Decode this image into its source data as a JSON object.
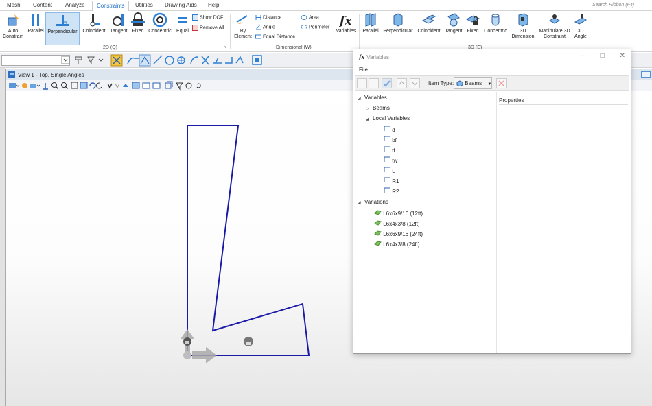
{
  "menu": {
    "tabs": [
      "Mesh",
      "Content",
      "Analyze",
      "Constraints",
      "Utilities",
      "Drawing Aids",
      "Help"
    ],
    "active": "Constraints",
    "search_placeholder": "Search Ribbon (F4)"
  },
  "ribbon": {
    "c2d": {
      "auto": "Auto Constrain",
      "parallel": "Parallel",
      "perpendicular": "Perpendicular",
      "coincident": "Coincident",
      "tangent": "Tangent",
      "fixed": "Fixed",
      "concentric": "Concentric",
      "equal": "Equal",
      "show_dof": "Show DOF",
      "remove_all": "Remove All",
      "group": "2D (Q)"
    },
    "dim": {
      "by_element": "By Element",
      "distance": "Distance",
      "angle": "Angle",
      "equal_distance": "Equal Distance",
      "area": "Area",
      "perimeter": "Perimeter",
      "variables": "Variables",
      "group": "Dimensional (W)"
    },
    "c3d": {
      "parallel": "Parallel",
      "perpendicular": "Perpendicular",
      "coincident": "Coincident",
      "tangent": "Tangent",
      "fixed": "Fixed",
      "concentric": "Concentric",
      "dimension": "3D Dimension",
      "manipulate": "Manipulate 3D Constraint",
      "angle": "3D Angle",
      "group": "3D (E)"
    }
  },
  "view": {
    "title": "View 1 - Top, Single Angles"
  },
  "dialog": {
    "title": "Variables",
    "menu_file": "File",
    "item_type_label": "Item Type:",
    "item_type_value": "Beams",
    "properties_label": "Properties",
    "tree": {
      "variables": "Variables",
      "beams": "Beams",
      "local_variables": "Local Variables",
      "locals": [
        "d",
        "bf",
        "tf",
        "tw",
        "L",
        "R1",
        "R2"
      ],
      "variations": "Variations",
      "variation_items": [
        "L6x6x9/16 (12ft)",
        "L6x4x3/8 (12ft)",
        "L6x6x9/16 (24ft)",
        "L6x4x3/8 (24ft)"
      ]
    }
  },
  "colors": {
    "accent": "#1a6fc4",
    "shape_stroke": "#1a1aa8",
    "selected_bg": "#cfe3f7",
    "variation_icon": "#7cc05a"
  }
}
